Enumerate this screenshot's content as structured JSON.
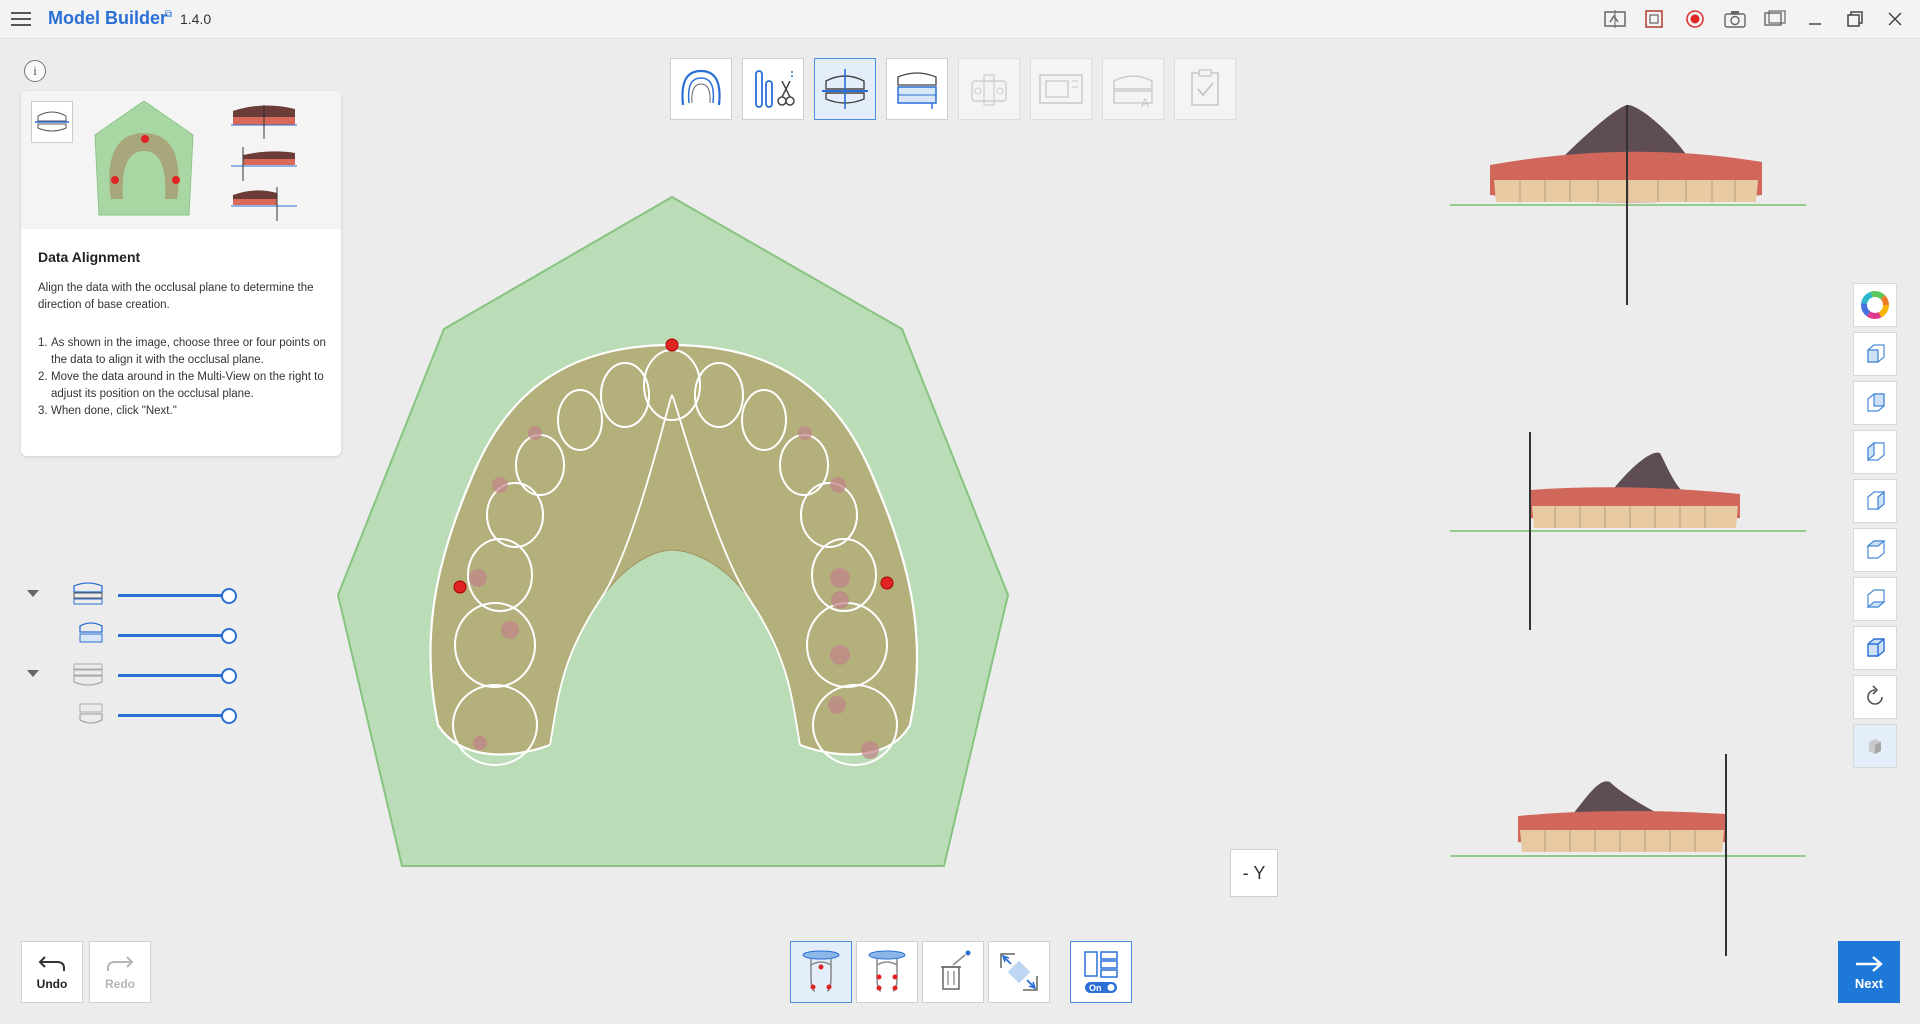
{
  "app": {
    "title": "Model Builder",
    "version": "1.4.0"
  },
  "titlebar": {
    "icons": [
      "compare-icon",
      "crop-icon",
      "record-icon",
      "camera-icon",
      "screen-capture-icon",
      "minimize-icon",
      "restore-icon",
      "close-icon"
    ]
  },
  "steps": [
    {
      "name": "arch-select-icon",
      "state": "done"
    },
    {
      "name": "trim-tools-icon",
      "state": "done"
    },
    {
      "name": "data-alignment-icon",
      "state": "active"
    },
    {
      "name": "base-creation-icon",
      "state": "available"
    },
    {
      "name": "model-step-5-icon",
      "state": "disabled"
    },
    {
      "name": "model-step-6-icon",
      "state": "disabled"
    },
    {
      "name": "model-step-7-icon",
      "state": "disabled"
    },
    {
      "name": "review-icon",
      "state": "disabled"
    }
  ],
  "guide": {
    "title": "Data Alignment",
    "description": "Align the data with the occlusal plane to determine the direction of base creation.",
    "steps": [
      {
        "num": "1.",
        "text": "As shown in the image, choose three or four points on the data to align it with the occlusal plane."
      },
      {
        "num": "2.",
        "text": "Move the data around in the Multi-View on the right to adjust its position on the occlusal plane."
      },
      {
        "num": "3.",
        "text": "When done, click \"Next.\""
      }
    ]
  },
  "layers": [
    {
      "name": "upper-jaw",
      "visibility": 1.0
    },
    {
      "name": "upper-jaw-sub",
      "visibility": 1.0
    },
    {
      "name": "lower-jaw",
      "visibility": 1.0
    },
    {
      "name": "lower-jaw-sub",
      "visibility": 1.0
    }
  ],
  "view": {
    "direction": "- Y"
  },
  "right_tools": [
    "color-wheel-icon",
    "front-view-icon",
    "back-view-icon",
    "left-view-icon",
    "right-view-icon",
    "top-view-icon",
    "bottom-view-icon",
    "iso-view-icon",
    "reset-rotation-icon",
    "solid-render-icon"
  ],
  "bottom_tools": [
    {
      "name": "three-point-align-icon",
      "active": true
    },
    {
      "name": "four-point-align-icon",
      "active": false
    },
    {
      "name": "clear-points-icon",
      "active": false
    },
    {
      "name": "fit-view-icon",
      "active": false
    },
    {
      "name": "multi-view-toggle-icon",
      "active": true,
      "badge": "On"
    }
  ],
  "actions": {
    "undo": "Undo",
    "redo": "Redo",
    "next": "Next"
  },
  "colors": {
    "accent": "#1e78d8",
    "plane": "#9fd39a",
    "gum": "#d06a5a"
  }
}
